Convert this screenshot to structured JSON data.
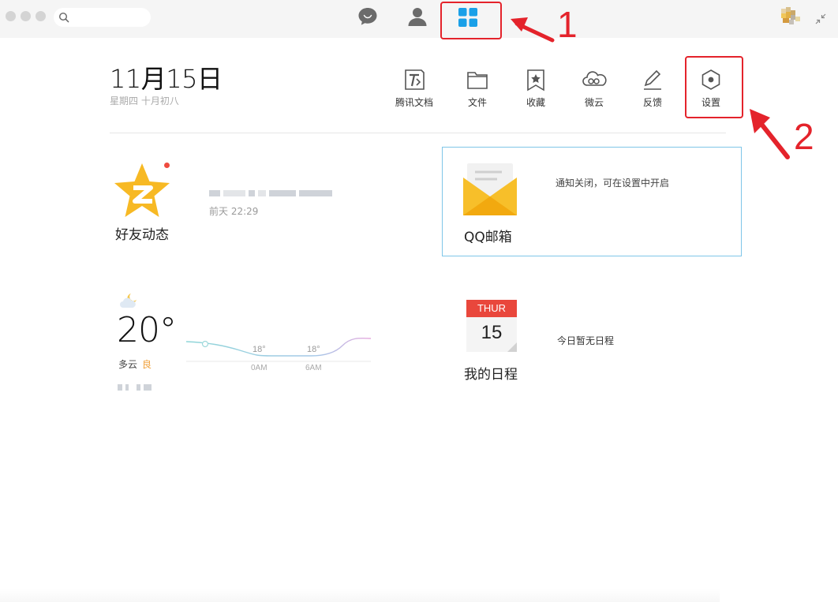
{
  "titlebar": {
    "search_placeholder": "",
    "nav": [
      "chat-icon",
      "contacts-icon",
      "apps-grid-icon"
    ],
    "active_nav": "apps-grid-icon"
  },
  "header": {
    "date": "11月15日",
    "subdate": "星期四  十月初八"
  },
  "tools": [
    {
      "label": "腾讯文档",
      "icon": "tencent-docs-icon"
    },
    {
      "label": "文件",
      "icon": "folder-icon"
    },
    {
      "label": "收藏",
      "icon": "bookmark-star-icon"
    },
    {
      "label": "微云",
      "icon": "weiyun-cloud-icon"
    },
    {
      "label": "反馈",
      "icon": "pencil-icon"
    },
    {
      "label": "设置",
      "icon": "settings-hexagon-icon"
    }
  ],
  "annotations": {
    "one": "1",
    "two": "2",
    "color": "#e4232b"
  },
  "feed": {
    "title": "好友动态",
    "time": "前天 22:29",
    "has_unread": true
  },
  "mail": {
    "title": "QQ邮箱",
    "note": "通知关闭，可在设置中开启"
  },
  "weather": {
    "temp": "20°",
    "condition": "多云",
    "quality": "良",
    "points": [
      {
        "time": "0AM",
        "temp": "18°"
      },
      {
        "time": "6AM",
        "temp": "18°"
      }
    ]
  },
  "calendar": {
    "weekday": "THUR",
    "day": "15",
    "title": "我的日程",
    "note": "今日暂无日程"
  },
  "colors": {
    "accent": "#1aa0e8",
    "mail_yellow": "#f7bf2a",
    "calendar_red": "#e9473c",
    "card_border": "#7fc6e8"
  }
}
